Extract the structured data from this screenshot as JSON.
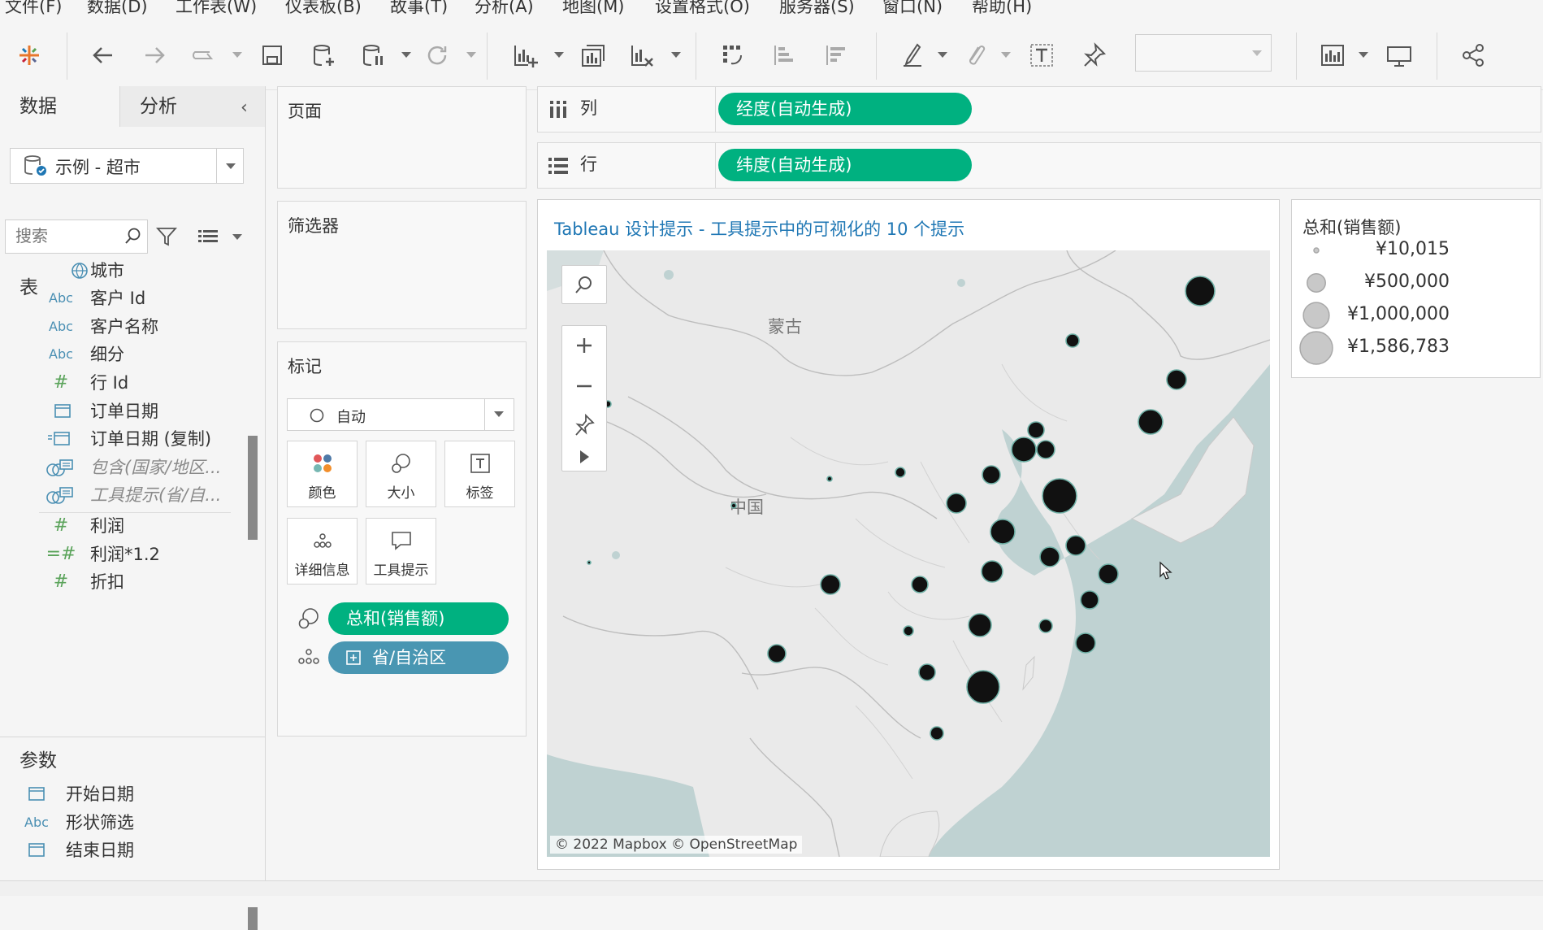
{
  "menu": [
    "文件(F)",
    "数据(D)",
    "工作表(W)",
    "仪表板(B)",
    "故事(T)",
    "分析(A)",
    "地图(M)",
    "设置格式(O)",
    "服务器(S)",
    "窗口(N)",
    "帮助(H)"
  ],
  "left_pane": {
    "tabs": {
      "data": "数据",
      "analysis": "分析"
    },
    "datasource": "示例 - 超市",
    "search_placeholder": "搜索",
    "tables_header": "表",
    "fields": [
      {
        "icon": "globe",
        "name": "城市"
      },
      {
        "icon": "Abc",
        "name": "客户 Id"
      },
      {
        "icon": "Abc",
        "name": "客户名称"
      },
      {
        "icon": "Abc",
        "name": "细分"
      },
      {
        "icon": "#",
        "name": "行 Id"
      },
      {
        "icon": "date",
        "name": "订单日期"
      },
      {
        "icon": "=date",
        "name": "订单日期 (复制)"
      },
      {
        "icon": "set",
        "name": "包含(国家/地区..."
      },
      {
        "icon": "set",
        "name": "工具提示(省/自..."
      },
      {
        "icon": "#",
        "name": "利润"
      },
      {
        "icon": "=#",
        "name": "利润*1.2"
      },
      {
        "icon": "#",
        "name": "折扣"
      }
    ],
    "params_header": "参数",
    "params": [
      {
        "icon": "date",
        "name": "开始日期"
      },
      {
        "icon": "Abc",
        "name": "形状筛选"
      },
      {
        "icon": "date",
        "name": "结束日期"
      }
    ]
  },
  "shelves": {
    "pages_title": "页面",
    "filters_title": "筛选器",
    "columns_label": "列",
    "columns_pill": "经度(自动生成)",
    "rows_label": "行",
    "rows_pill": "纬度(自动生成)"
  },
  "marks": {
    "title": "标记",
    "type": "自动",
    "buttons": [
      "颜色",
      "大小",
      "标签",
      "详细信息",
      "工具提示"
    ],
    "pills": [
      {
        "kind": "size",
        "label": "总和(销售额)"
      },
      {
        "kind": "detail",
        "label": "省/自治区"
      }
    ]
  },
  "view": {
    "title": "Tableau 设计提示 - 工具提示中的可视化的 10 个提示",
    "attribution": "© 2022 Mapbox © OpenStreetMap",
    "map_labels": [
      "蒙古",
      "中国"
    ]
  },
  "legend": {
    "title": "总和(销售额)",
    "items": [
      {
        "value": "¥10,015",
        "amount": 10015
      },
      {
        "value": "¥500,000",
        "amount": 500000
      },
      {
        "value": "¥1,000,000",
        "amount": 1000000
      },
      {
        "value": "¥1,586,783",
        "amount": 1586783
      }
    ]
  },
  "colors": {
    "pill_green": "#00b180",
    "pill_blue": "#4996b2",
    "title_blue": "#1f77b4",
    "sea": "#bfd2d2",
    "land": "#eaeaea"
  }
}
